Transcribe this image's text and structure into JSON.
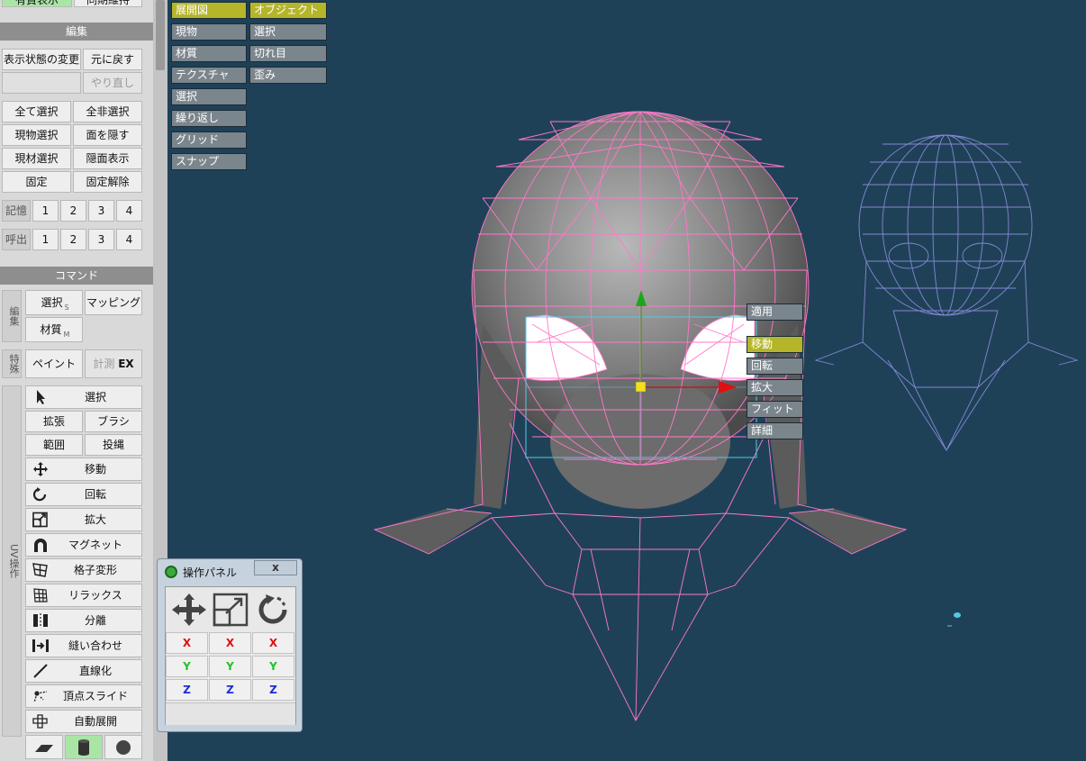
{
  "top_buttons": {
    "left": "有賞表示",
    "right": "同期維持"
  },
  "edit_section": {
    "title": "編集",
    "change_display": "表示状態の変更",
    "undo": "元に戻す",
    "redo": "やり直し",
    "select_all": "全て選択",
    "deselect_all": "全非選択",
    "select_object": "現物選択",
    "hide_face": "面を隠す",
    "select_material": "現材選択",
    "show_hidden": "隠面表示",
    "fix": "固定",
    "unfix": "固定解除",
    "memory_label": "記憶",
    "recall_label": "呼出",
    "slots": [
      "1",
      "2",
      "3",
      "4"
    ]
  },
  "command_section": {
    "title": "コマンド",
    "edit_group_label": "編集",
    "select": "選択",
    "select_sub": "S",
    "mapping": "マッピング",
    "material": "材質",
    "material_sub": "M",
    "special_group_label": "特殊",
    "paint": "ペイント",
    "measure": "計測",
    "measure_ex": "EX",
    "uv_group_label": "UV操作",
    "uv_select": "選択",
    "expand": "拡張",
    "brush": "ブラシ",
    "range": "範囲",
    "lasso": "投縄",
    "tools": [
      {
        "label": "移動",
        "icon": "move-icon"
      },
      {
        "label": "回転",
        "icon": "rotate-icon"
      },
      {
        "label": "拡大",
        "icon": "scale-icon"
      },
      {
        "label": "マグネット",
        "icon": "magnet-icon"
      },
      {
        "label": "格子変形",
        "icon": "lattice-icon"
      },
      {
        "label": "リラックス",
        "icon": "relax-icon"
      },
      {
        "label": "分離",
        "icon": "split-icon"
      },
      {
        "label": "縫い合わせ",
        "icon": "sew-icon"
      },
      {
        "label": "直線化",
        "icon": "straighten-icon"
      },
      {
        "label": "頂点スライド",
        "icon": "vertex-slide-icon"
      },
      {
        "label": "自動展開",
        "icon": "auto-unwrap-icon"
      }
    ],
    "projection_icons": [
      "plane-icon",
      "cylinder-icon",
      "sphere-icon"
    ]
  },
  "view_tabs": {
    "col1": [
      {
        "label": "展開図",
        "active": true
      },
      {
        "label": "現物",
        "active": false
      },
      {
        "label": "材質",
        "active": false
      },
      {
        "label": "テクスチャ",
        "active": false
      },
      {
        "label": "選択",
        "active": false
      },
      {
        "label": "繰り返し",
        "active": false
      },
      {
        "label": "グリッド",
        "active": false
      },
      {
        "label": "スナップ",
        "active": false
      }
    ],
    "col2": [
      {
        "label": "オブジェクト",
        "active": true
      },
      {
        "label": "選択",
        "active": false
      },
      {
        "label": "切れ目",
        "active": false
      },
      {
        "label": "歪み",
        "active": false
      }
    ]
  },
  "gizmo_menu": {
    "apply": "適用",
    "items": [
      {
        "label": "移動",
        "active": true
      },
      {
        "label": "回転",
        "active": false
      },
      {
        "label": "拡大",
        "active": false
      },
      {
        "label": "フィット",
        "active": false
      },
      {
        "label": "詳細",
        "active": false
      }
    ]
  },
  "op_panel": {
    "title": "操作パネル",
    "close": "x",
    "axes": [
      "X",
      "Y",
      "Z"
    ],
    "axis_colors": {
      "X": "#e01010",
      "Y": "#22c422",
      "Z": "#1a2fd6"
    }
  },
  "colors": {
    "viewport_bg": "#1f4158",
    "uv_wire": "#ff78c8",
    "mesh_wire": "#8f8fe0",
    "active_tab": "#b5b52a"
  }
}
